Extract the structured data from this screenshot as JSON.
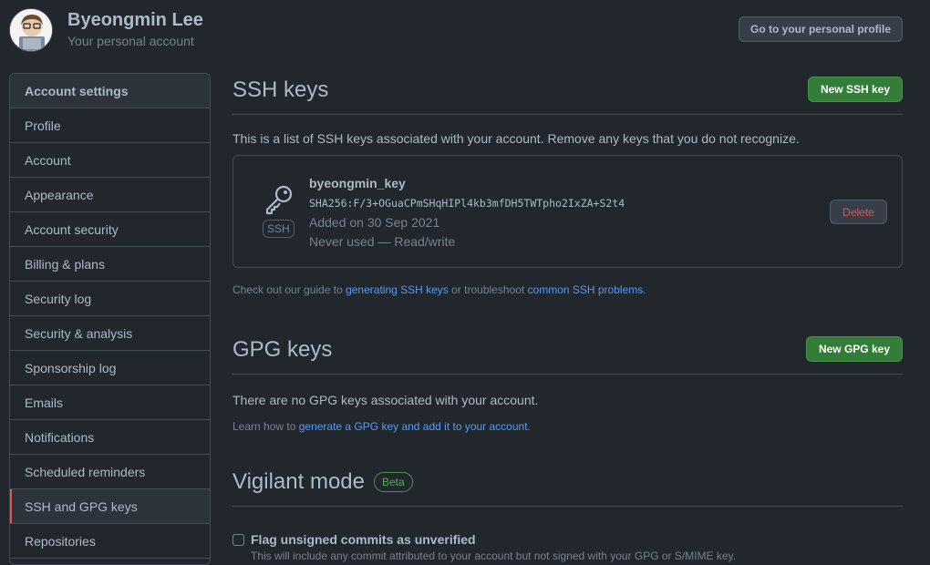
{
  "user": {
    "name": "Byeongmin Lee",
    "subtitle": "Your personal account",
    "profile_button": "Go to your personal profile"
  },
  "sidebar": {
    "header": "Account settings",
    "items": [
      {
        "label": "Profile"
      },
      {
        "label": "Account"
      },
      {
        "label": "Appearance"
      },
      {
        "label": "Account security"
      },
      {
        "label": "Billing & plans"
      },
      {
        "label": "Security log"
      },
      {
        "label": "Security & analysis"
      },
      {
        "label": "Sponsorship log"
      },
      {
        "label": "Emails"
      },
      {
        "label": "Notifications"
      },
      {
        "label": "Scheduled reminders"
      },
      {
        "label": "SSH and GPG keys",
        "selected": true
      },
      {
        "label": "Repositories"
      }
    ]
  },
  "ssh": {
    "title": "SSH keys",
    "new_button": "New SSH key",
    "description": "This is a list of SSH keys associated with your account. Remove any keys that you do not recognize.",
    "key": {
      "type_label": "SSH",
      "name": "byeongmin_key",
      "fingerprint": "SHA256:F/3+OGuaCPmSHqHIPl4kb3mfDH5TWTpho2IxZA+S2t4",
      "added": "Added on 30 Sep 2021",
      "usage": "Never used — Read/write",
      "delete_label": "Delete"
    },
    "note_prefix": "Check out our guide to ",
    "note_link1": "generating SSH keys",
    "note_mid": " or troubleshoot ",
    "note_link2": "common SSH problems",
    "note_suffix": "."
  },
  "gpg": {
    "title": "GPG keys",
    "new_button": "New GPG key",
    "description": "There are no GPG keys associated with your account.",
    "note_prefix": "Learn how to ",
    "note_link": "generate a GPG key and add it to your account",
    "note_suffix": "."
  },
  "vigilant": {
    "title": "Vigilant mode",
    "badge": "Beta",
    "checkbox_label": "Flag unsigned commits as unverified",
    "checkbox_desc": "This will include any commit attributed to your account but not signed with your GPG or S/MIME key."
  }
}
